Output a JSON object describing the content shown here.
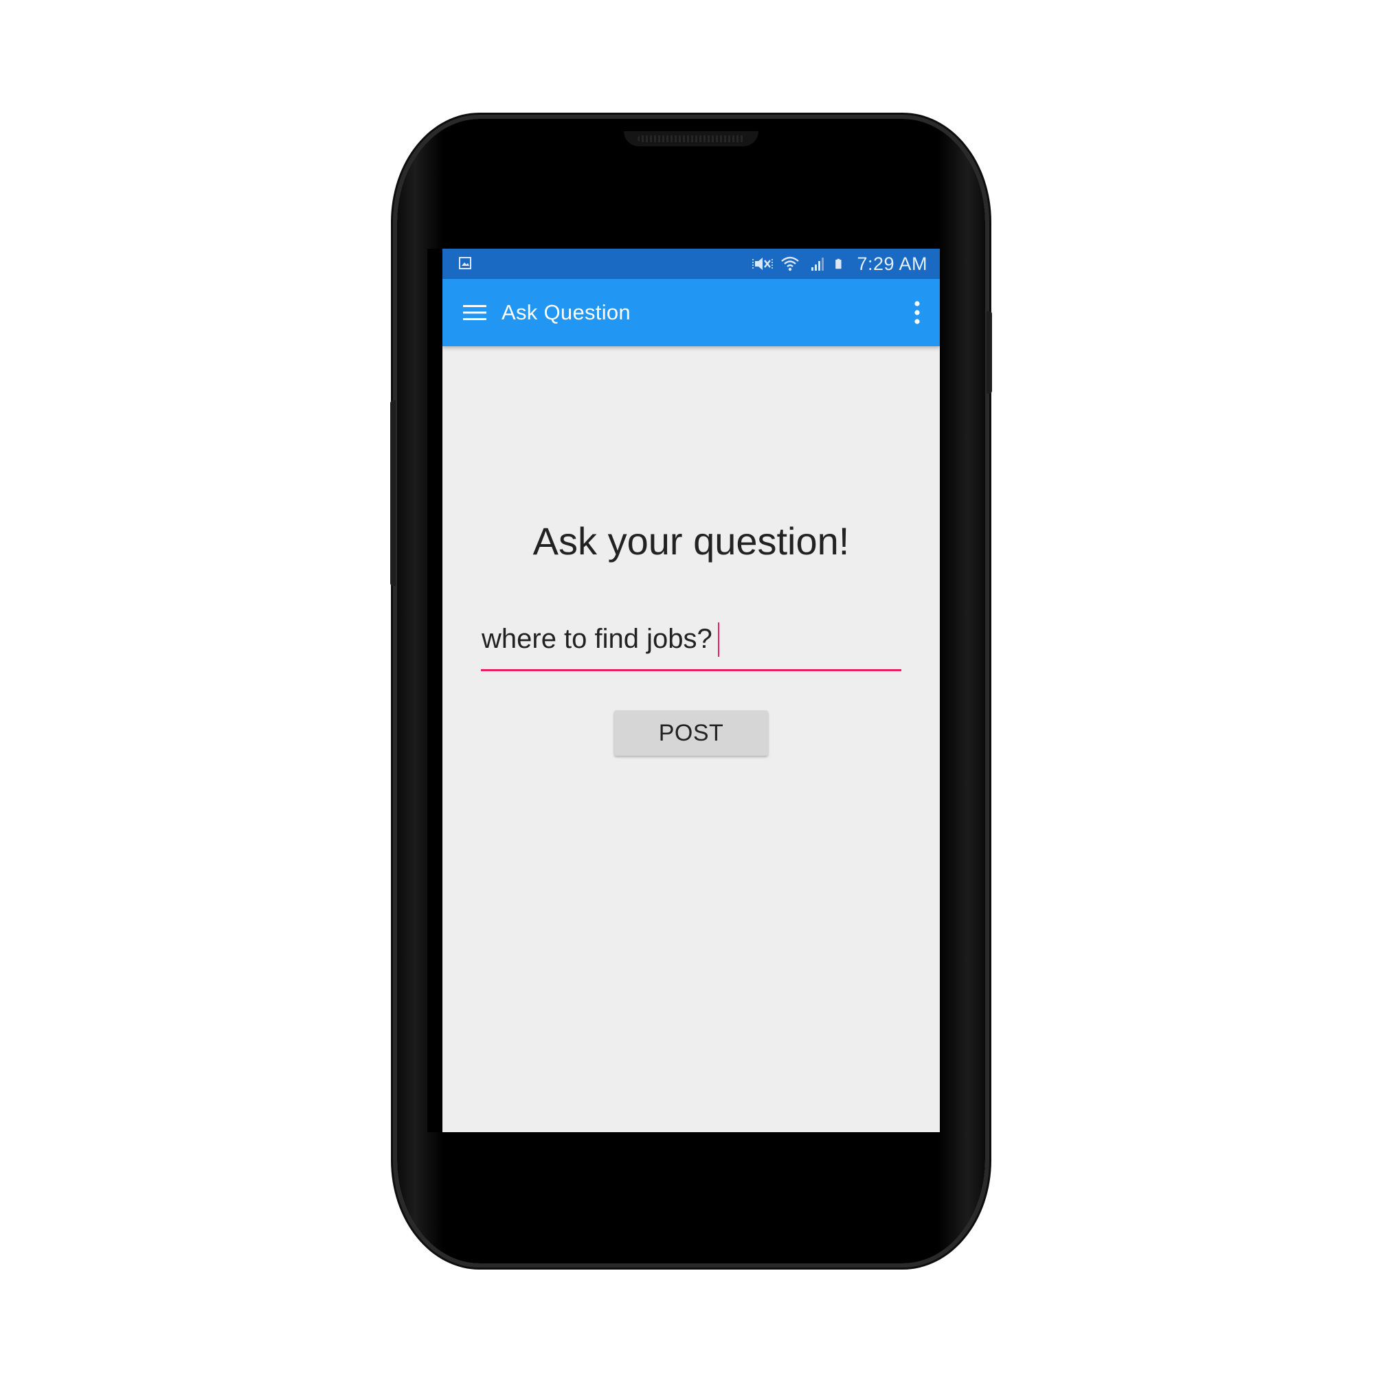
{
  "status_bar": {
    "time": "7:29 AM",
    "left_icon": "image-notification-icon",
    "icons": [
      "mute-icon",
      "wifi-icon",
      "signal-icon",
      "battery-icon"
    ],
    "background_color": "#1a69c2"
  },
  "app_bar": {
    "title": "Ask Question",
    "nav_icon": "hamburger-menu-icon",
    "overflow_icon": "more-vert-icon",
    "background_color": "#2196f3"
  },
  "main": {
    "heading": "Ask your question!",
    "question_input": {
      "value": "where to find jobs?",
      "accent_color": "#e91e63"
    },
    "post_button": {
      "label": "POST"
    },
    "background_color": "#eeeeee"
  }
}
